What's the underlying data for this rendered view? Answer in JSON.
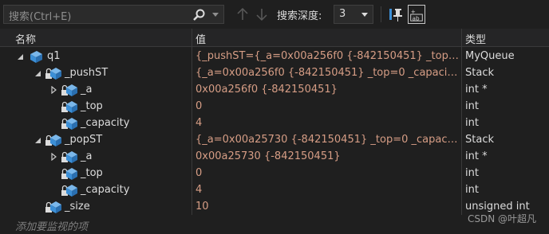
{
  "toolbar": {
    "search_placeholder": "搜索(Ctrl+E)",
    "search_depth_label": "搜索深度:",
    "search_depth_value": "3"
  },
  "columns": {
    "name": "名称",
    "value": "值",
    "type": "类型"
  },
  "rows": [
    {
      "name": "q1",
      "value": "{_pushST={_a=0x00a256f0 {-842150451} _top=0 ...",
      "type": "MyQueue"
    },
    {
      "name": "_pushST",
      "value": "{_a=0x00a256f0 {-842150451} _top=0 _capacity=...",
      "type": "Stack"
    },
    {
      "name": "_a",
      "value": "0x00a256f0 {-842150451}",
      "type": "int *"
    },
    {
      "name": "_top",
      "value": "0",
      "type": "int"
    },
    {
      "name": "_capacity",
      "value": "4",
      "type": "int"
    },
    {
      "name": "_popST",
      "value": "{_a=0x00a25730 {-842150451} _top=0 _capacity...",
      "type": "Stack"
    },
    {
      "name": "_a",
      "value": "0x00a25730 {-842150451}",
      "type": "int *"
    },
    {
      "name": "_top",
      "value": "0",
      "type": "int"
    },
    {
      "name": "_capacity",
      "value": "4",
      "type": "int"
    },
    {
      "name": "_size",
      "value": "10",
      "type": "unsigned int"
    }
  ],
  "add_watch_placeholder": "添加要监视的项",
  "watermark": "CSDN @叶超凡",
  "colors": {
    "value_text": "#d69d85",
    "background": "#1f1f1f",
    "icon_blue": "#3c8fd6"
  }
}
